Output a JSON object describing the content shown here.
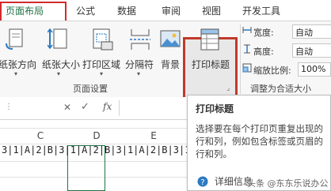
{
  "tabs": [
    "页面布局",
    "公式",
    "数据",
    "审阅",
    "视图",
    "开发工具"
  ],
  "ribbon": {
    "buttons": [
      {
        "label": "纸张方向",
        "icon": "page-orientation-icon"
      },
      {
        "label": "纸张大小",
        "icon": "paper-size-icon"
      },
      {
        "label": "打印区域",
        "icon": "print-area-icon"
      },
      {
        "label": "分隔符",
        "icon": "breaks-icon"
      },
      {
        "label": "背景",
        "icon": "background-icon"
      },
      {
        "label": "打印标题",
        "icon": "print-titles-icon"
      }
    ],
    "group_page_setup": "页面设置",
    "group_scale": "调整为合适大小",
    "width_label": "宽度:",
    "width_value": "自动",
    "height_label": "高度:",
    "height_value": "自动",
    "scale_label": "缩放比例:",
    "scale_value": "100%"
  },
  "formula": {
    "cancel": "✕",
    "confirm": "✓",
    "fx": "fx"
  },
  "columns": [
    "C",
    "D",
    "E",
    "H"
  ],
  "row_text": "3|1|A|2|B|3|1|A|2|B|3|1|A|2|B|3|1|A|2|B|3|1|A|2",
  "tooltip": {
    "title": "打印标题",
    "description": "选择要在每个打印页重复出现的行和列，例如包含标签或页眉的行和列。",
    "more": "详细信息"
  },
  "watermark": "头条 @东东乐说办公"
}
